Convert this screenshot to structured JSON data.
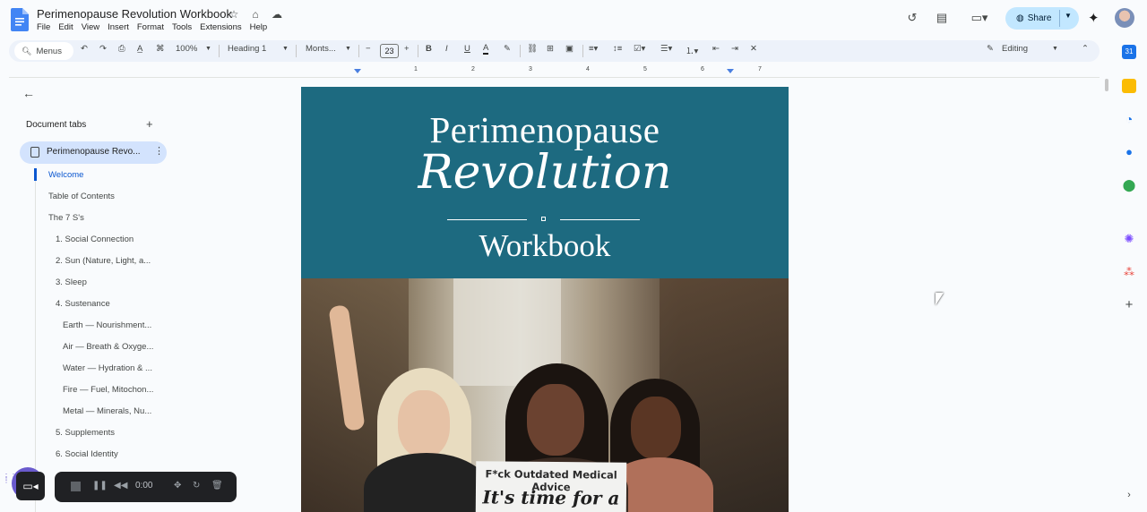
{
  "doc": {
    "title": "Perimenopause Revolution Workbook",
    "menu": [
      "File",
      "Edit",
      "View",
      "Insert",
      "Format",
      "Tools",
      "Extensions",
      "Help"
    ]
  },
  "header": {
    "share_label": "Share",
    "icons": [
      "history-icon",
      "comment-icon",
      "meet-icon",
      "gemini-icon",
      "avatar"
    ]
  },
  "toolbar": {
    "menus_label": "Menus",
    "zoom": "100%",
    "style": "Heading 1",
    "font": "Monts...",
    "font_size": "23",
    "mode": "Editing"
  },
  "ruler": {
    "numbers": [
      "1",
      "2",
      "3",
      "4",
      "5",
      "6",
      "7"
    ]
  },
  "sidebar": {
    "heading": "Document tabs",
    "active_tab": "Perimenopause Revo...",
    "outline": [
      {
        "label": "Welcome",
        "active": true
      },
      {
        "label": "Table of Contents"
      },
      {
        "label": "The 7 S's"
      },
      {
        "label": "1. Social Connection"
      },
      {
        "label": "2. Sun (Nature, Light, a..."
      },
      {
        "label": "3. Sleep"
      },
      {
        "label": "4. Sustenance"
      },
      {
        "label": "Earth — Nourishment..."
      },
      {
        "label": "Air — Breath & Oxyge..."
      },
      {
        "label": "Water — Hydration & ..."
      },
      {
        "label": "Fire — Fuel, Mitochon..."
      },
      {
        "label": "Metal — Minerals, Nu..."
      },
      {
        "label": "5. Supplements"
      },
      {
        "label": "6. Social Identity"
      }
    ]
  },
  "document": {
    "banner_line1": "Perimenopause",
    "banner_line2": "Revolution",
    "banner_line3": "Workbook",
    "banner_color": "#1d6a80",
    "sign_line1": "F*ck Outdated Medical Advice",
    "sign_line2": "It's time for a"
  },
  "recorder": {
    "time": "0:00"
  },
  "colors": {
    "share_bg": "#c2e7ff",
    "active_tab_bg": "#d3e3fd",
    "outline_active": "#0b57d0"
  }
}
